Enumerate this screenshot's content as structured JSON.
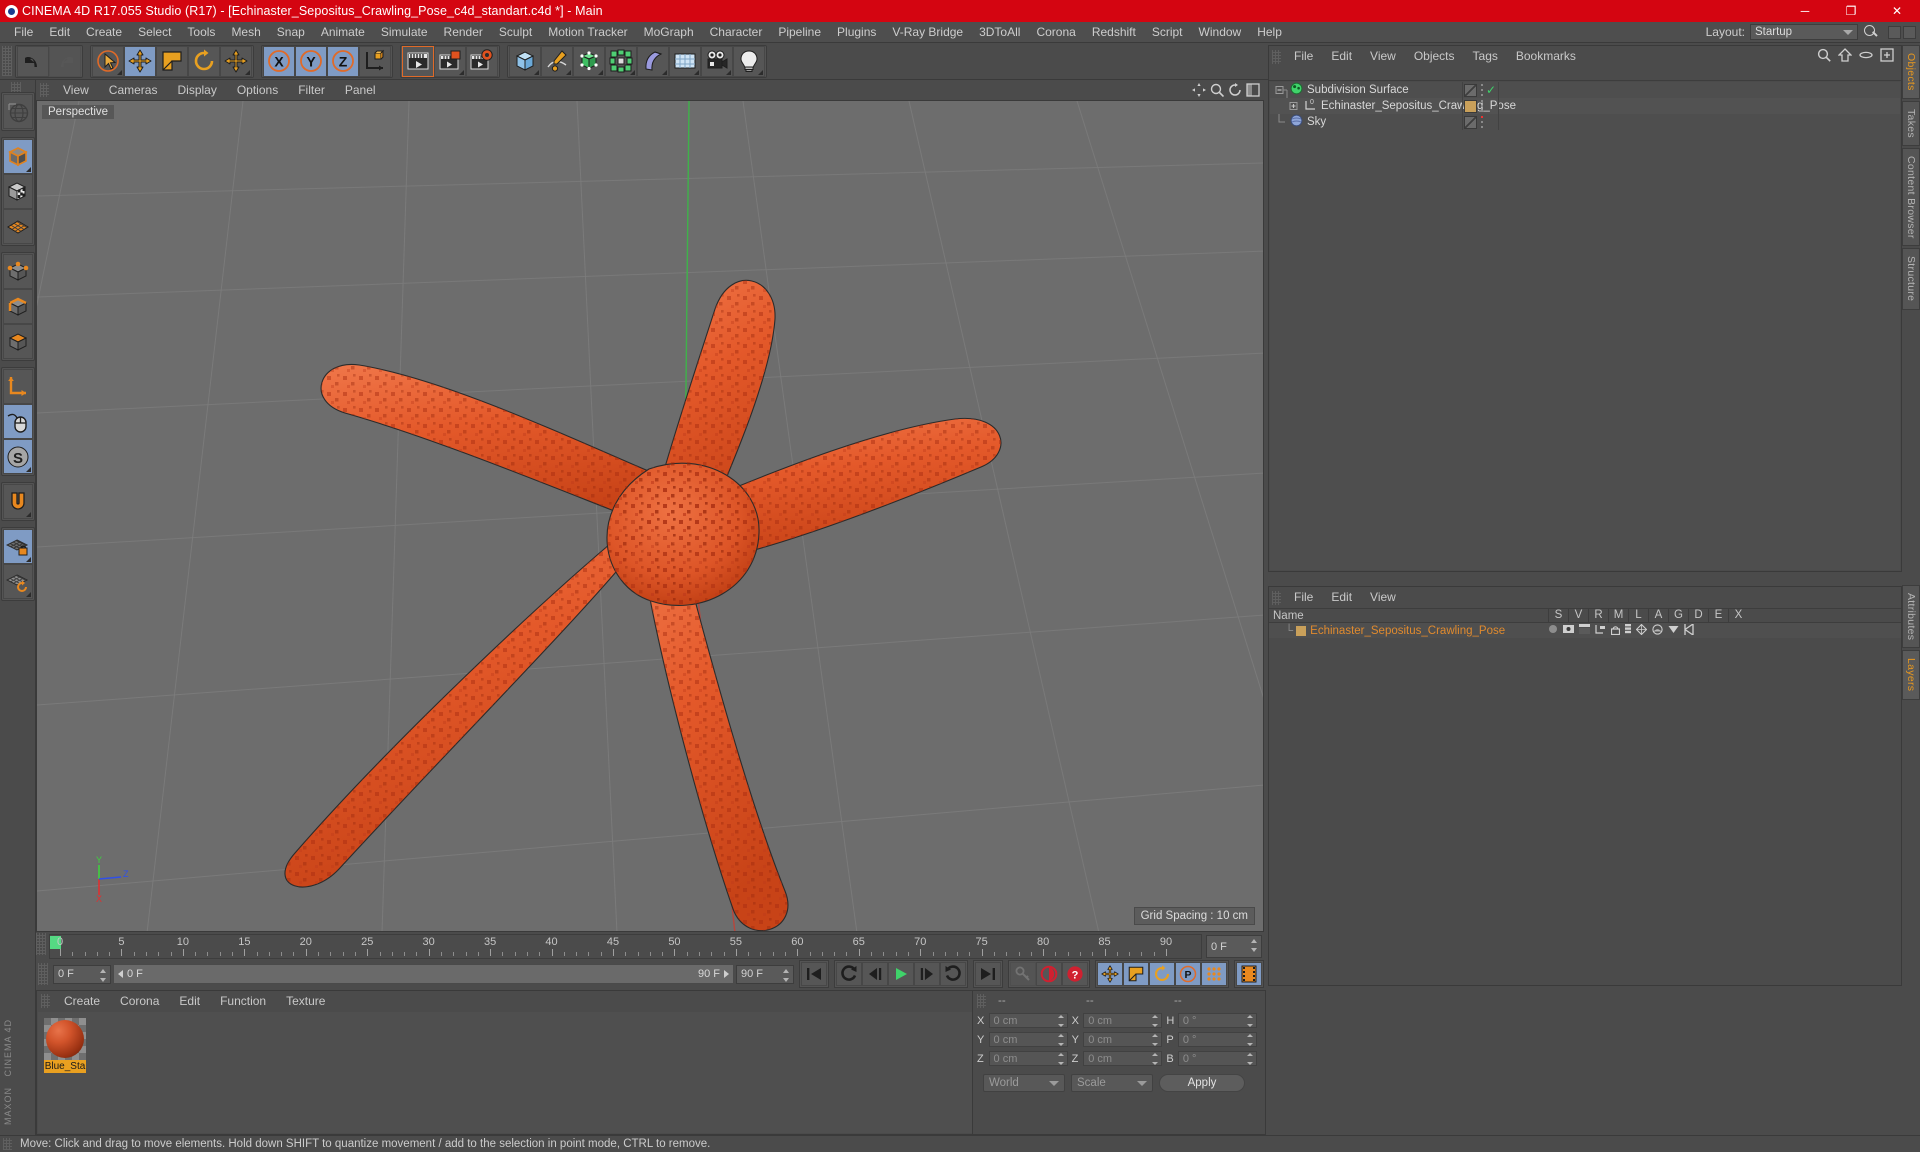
{
  "window": {
    "title": "CINEMA 4D R17.055 Studio (R17) - [Echinaster_Sepositus_Crawling_Pose_c4d_standart.c4d *] - Main",
    "minimize": "─",
    "maximize": "❐",
    "close": "✕",
    "titlebar_color": "#d40511"
  },
  "menubar": {
    "items": [
      {
        "label": "File"
      },
      {
        "label": "Edit"
      },
      {
        "label": "Create"
      },
      {
        "label": "Select"
      },
      {
        "label": "Tools"
      },
      {
        "label": "Mesh"
      },
      {
        "label": "Snap"
      },
      {
        "label": "Animate"
      },
      {
        "label": "Simulate"
      },
      {
        "label": "Render"
      },
      {
        "label": "Sculpt"
      },
      {
        "label": "Motion Tracker"
      },
      {
        "label": "MoGraph"
      },
      {
        "label": "Character"
      },
      {
        "label": "Pipeline"
      },
      {
        "label": "Plugins"
      },
      {
        "label": "V-Ray Bridge"
      },
      {
        "label": "3DToAll"
      },
      {
        "label": "Corona"
      },
      {
        "label": "Redshift"
      },
      {
        "label": "Script"
      },
      {
        "label": "Window"
      },
      {
        "label": "Help"
      }
    ],
    "layout_label": "Layout:",
    "layout_value": "Startup"
  },
  "toolbar": {
    "groups": [
      {
        "buttons": [
          {
            "name": "undo-button",
            "icon": "undo-icon",
            "selected": false,
            "disabled": false
          },
          {
            "name": "redo-button",
            "icon": "redo-icon",
            "selected": false,
            "disabled": true
          }
        ]
      },
      {
        "buttons": [
          {
            "name": "live-selection-tool",
            "icon": "cursor-circle-icon",
            "selected": false,
            "corner": true
          },
          {
            "name": "move-tool",
            "icon": "move-arrows-icon",
            "selected": true
          },
          {
            "name": "scale-tool",
            "icon": "scale-box-icon",
            "selected": false
          },
          {
            "name": "rotate-tool",
            "icon": "rotate-circle-icon",
            "selected": false
          },
          {
            "name": "axis-move-tool",
            "icon": "move-arrows-icon",
            "selected": false,
            "corner": true
          }
        ]
      },
      {
        "buttons": [
          {
            "name": "x-axis-lock",
            "icon": "x-axis-icon",
            "selected": true,
            "label": "X"
          },
          {
            "name": "y-axis-lock",
            "icon": "y-axis-icon",
            "selected": true,
            "label": "Y"
          },
          {
            "name": "z-axis-lock",
            "icon": "z-axis-icon",
            "selected": true,
            "label": "Z"
          },
          {
            "name": "world-object-coord-toggle",
            "icon": "world-axis-icon",
            "selected": false
          }
        ]
      },
      {
        "buttons": [
          {
            "name": "render-view-button",
            "icon": "render-view-icon",
            "selected": false,
            "active_border": true
          },
          {
            "name": "render-region-button",
            "icon": "render-region-icon",
            "selected": false,
            "corner": true
          },
          {
            "name": "render-settings-button",
            "icon": "render-settings-icon",
            "selected": false
          }
        ]
      },
      {
        "buttons": [
          {
            "name": "add-cube-button",
            "icon": "cube-icon",
            "selected": false,
            "corner": true
          },
          {
            "name": "add-spline-button",
            "icon": "pen-spline-icon",
            "selected": false,
            "corner": true
          },
          {
            "name": "add-generator-button",
            "icon": "green-cube-icon",
            "selected": false,
            "corner": true
          },
          {
            "name": "add-array-button",
            "icon": "green-array-icon",
            "selected": false,
            "corner": true
          },
          {
            "name": "add-deformer-button",
            "icon": "bend-deformer-icon",
            "selected": false,
            "corner": true
          },
          {
            "name": "add-environment-button",
            "icon": "floor-grid-icon",
            "selected": false,
            "corner": true
          },
          {
            "name": "add-camera-button",
            "icon": "camera-icon",
            "selected": false,
            "corner": true
          },
          {
            "name": "add-light-button",
            "icon": "light-bulb-icon",
            "selected": false,
            "corner": true
          }
        ]
      }
    ]
  },
  "left_toolbar": {
    "groups": [
      {
        "buttons": [
          {
            "name": "viewport-navigation-tool",
            "icon": "globe-wire-icon",
            "selected": false
          }
        ]
      },
      {
        "buttons": [
          {
            "name": "make-editable-button",
            "icon": "editable-cube-icon",
            "selected": true,
            "corner": true
          },
          {
            "name": "texture-mode-button",
            "icon": "checker-cube-icon",
            "selected": false
          },
          {
            "name": "viewport-solo-button",
            "icon": "orange-grid-icon",
            "selected": false
          }
        ]
      },
      {
        "buttons": [
          {
            "name": "points-mode-button",
            "icon": "points-cube-icon",
            "selected": false
          },
          {
            "name": "edges-mode-button",
            "icon": "edges-cube-icon",
            "selected": false
          },
          {
            "name": "polygons-mode-button",
            "icon": "polygons-cube-icon",
            "selected": false
          }
        ]
      },
      {
        "buttons": [
          {
            "name": "axis-modify-button",
            "icon": "axis-l-icon",
            "selected": false
          },
          {
            "name": "enable-snapping-button",
            "icon": "mouse-icon",
            "selected": true
          },
          {
            "name": "workplane-button",
            "icon": "s-circle-icon",
            "selected": true,
            "corner": true
          }
        ]
      },
      {
        "buttons": [
          {
            "name": "magnet-tool-button",
            "icon": "magnet-icon",
            "selected": false,
            "corner": true
          }
        ]
      },
      {
        "buttons": [
          {
            "name": "lock-workplane-button",
            "icon": "grid-lock-icon",
            "selected": true,
            "corner": true
          },
          {
            "name": "planar-workplane-button",
            "icon": "grid-rotate-icon",
            "selected": false,
            "corner": true
          }
        ]
      }
    ],
    "branding_line1": "CINEMA 4D",
    "branding_line2": "MAXON"
  },
  "viewport": {
    "menu": [
      {
        "label": "View"
      },
      {
        "label": "Cameras"
      },
      {
        "label": "Display"
      },
      {
        "label": "Options"
      },
      {
        "label": "Filter"
      },
      {
        "label": "Panel"
      }
    ],
    "view_label": "Perspective",
    "grid_spacing": "Grid Spacing : 10 cm",
    "axis": {
      "x": "X",
      "y": "Y",
      "z": "Z",
      "x_color": "#e03030",
      "y_color": "#30d040",
      "z_color": "#3050e8"
    },
    "background_color": "#6d6d6d",
    "model": {
      "name": "Echinaster Sepositus starfish",
      "body_color": "#e4592a",
      "speckle_color": "#a62d12"
    }
  },
  "object_manager": {
    "menu": [
      {
        "label": "File"
      },
      {
        "label": "Edit"
      },
      {
        "label": "View"
      },
      {
        "label": "Objects"
      },
      {
        "label": "Tags"
      },
      {
        "label": "Bookmarks"
      }
    ],
    "rows": [
      {
        "name": "Subdivision Surface",
        "indent": 0,
        "icon": "subdivision-surface-icon",
        "icon_color": "#3fd36a",
        "tag_color": "#808080",
        "check": true,
        "dot": null
      },
      {
        "name": "Echinaster_Sepositus_Crawling_Pose",
        "indent": 1,
        "icon": "polygon-object-icon",
        "icon_color": "#d8d8d8",
        "tag_color": "#c9a05a",
        "check": false,
        "dot": null
      },
      {
        "name": "Sky",
        "indent": 0,
        "icon": "sky-object-icon",
        "icon_color": "#8fa6d8",
        "tag_color": "#808080",
        "check": false,
        "dot": "#e33"
      }
    ]
  },
  "layer_manager": {
    "menu": [
      {
        "label": "File"
      },
      {
        "label": "Edit"
      },
      {
        "label": "View"
      }
    ],
    "columns": [
      "Name",
      "S",
      "V",
      "R",
      "M",
      "L",
      "A",
      "G",
      "D",
      "E",
      "X"
    ],
    "rows": [
      {
        "name": "Echinaster_Sepositus_Crawling_Pose",
        "color": "#c9a05a"
      }
    ]
  },
  "material_manager": {
    "menu": [
      {
        "label": "Create"
      },
      {
        "label": "Corona"
      },
      {
        "label": "Edit"
      },
      {
        "label": "Function"
      },
      {
        "label": "Texture"
      }
    ],
    "materials": [
      {
        "name": "Blue_Sta",
        "full_name": "Blue_Starfish",
        "color": "#d2542b",
        "selected": true
      }
    ]
  },
  "coordinates": {
    "header": [
      "--",
      "--",
      "--"
    ],
    "rows": [
      {
        "label1": "X",
        "value1": "0 cm",
        "label2": "X",
        "value2": "0 cm",
        "label3": "H",
        "value3": "0 °"
      },
      {
        "label1": "Y",
        "value1": "0 cm",
        "label2": "Y",
        "value2": "0 cm",
        "label3": "P",
        "value3": "0 °"
      },
      {
        "label1": "Z",
        "value1": "0 cm",
        "label2": "Z",
        "value2": "0 cm",
        "label3": "B",
        "value3": "0 °"
      }
    ],
    "coord_system": "World",
    "transform_mode": "Scale",
    "apply_label": "Apply"
  },
  "timeline": {
    "current_frame": "0 F",
    "start_frame": "0 F",
    "end_frame": "90 F",
    "preview_end": "90 F",
    "max_frame": "0 F",
    "ticks": [
      0,
      5,
      10,
      15,
      20,
      25,
      30,
      35,
      40,
      45,
      50,
      55,
      60,
      65,
      70,
      75,
      80,
      85,
      90
    ],
    "transport": [
      {
        "name": "go-to-start-button",
        "icon": "skip-start-icon"
      },
      {
        "name": "previous-key-button",
        "icon": "prev-key-icon"
      },
      {
        "name": "step-back-button",
        "icon": "step-back-icon"
      },
      {
        "name": "play-button",
        "icon": "play-icon",
        "accent": "#3fd36a"
      },
      {
        "name": "step-forward-button",
        "icon": "step-forward-icon"
      },
      {
        "name": "next-key-button",
        "icon": "next-key-icon"
      },
      {
        "name": "go-to-end-button",
        "icon": "skip-end-icon"
      }
    ],
    "record_group": [
      {
        "name": "autokey-button",
        "icon": "key-icon",
        "disabled": true
      },
      {
        "name": "record-active-objects-button",
        "icon": "record-icon",
        "accent": "#d23"
      },
      {
        "name": "auto-keyframing-button",
        "icon": "question-record-icon",
        "accent": "#d23"
      }
    ],
    "key_group": [
      {
        "name": "key-position-button",
        "icon": "move-arrows-icon",
        "selected": true
      },
      {
        "name": "key-scale-button",
        "icon": "scale-box-icon",
        "selected": true
      },
      {
        "name": "key-rotation-button",
        "icon": "rotate-circle-icon",
        "selected": true
      },
      {
        "name": "key-param-button",
        "icon": "p-circle-icon",
        "selected": true
      },
      {
        "name": "key-pla-button",
        "icon": "point-level-icon",
        "selected": true
      }
    ],
    "extra_group": [
      {
        "name": "timeline-mode-button",
        "icon": "film-strip-icon",
        "selected": true
      }
    ]
  },
  "vertical_tabs": {
    "top": [
      {
        "label": "Objects",
        "active": true
      },
      {
        "label": "Takes",
        "active": false
      },
      {
        "label": "Content Browser",
        "active": false
      },
      {
        "label": "Structure",
        "active": false
      }
    ],
    "bottom": [
      {
        "label": "Attributes",
        "active": false
      },
      {
        "label": "Layers",
        "active": true
      }
    ]
  },
  "status_bar": {
    "message": "Move: Click and drag to move elements. Hold down SHIFT to quantize movement / add to the selection in point mode, CTRL to remove."
  }
}
